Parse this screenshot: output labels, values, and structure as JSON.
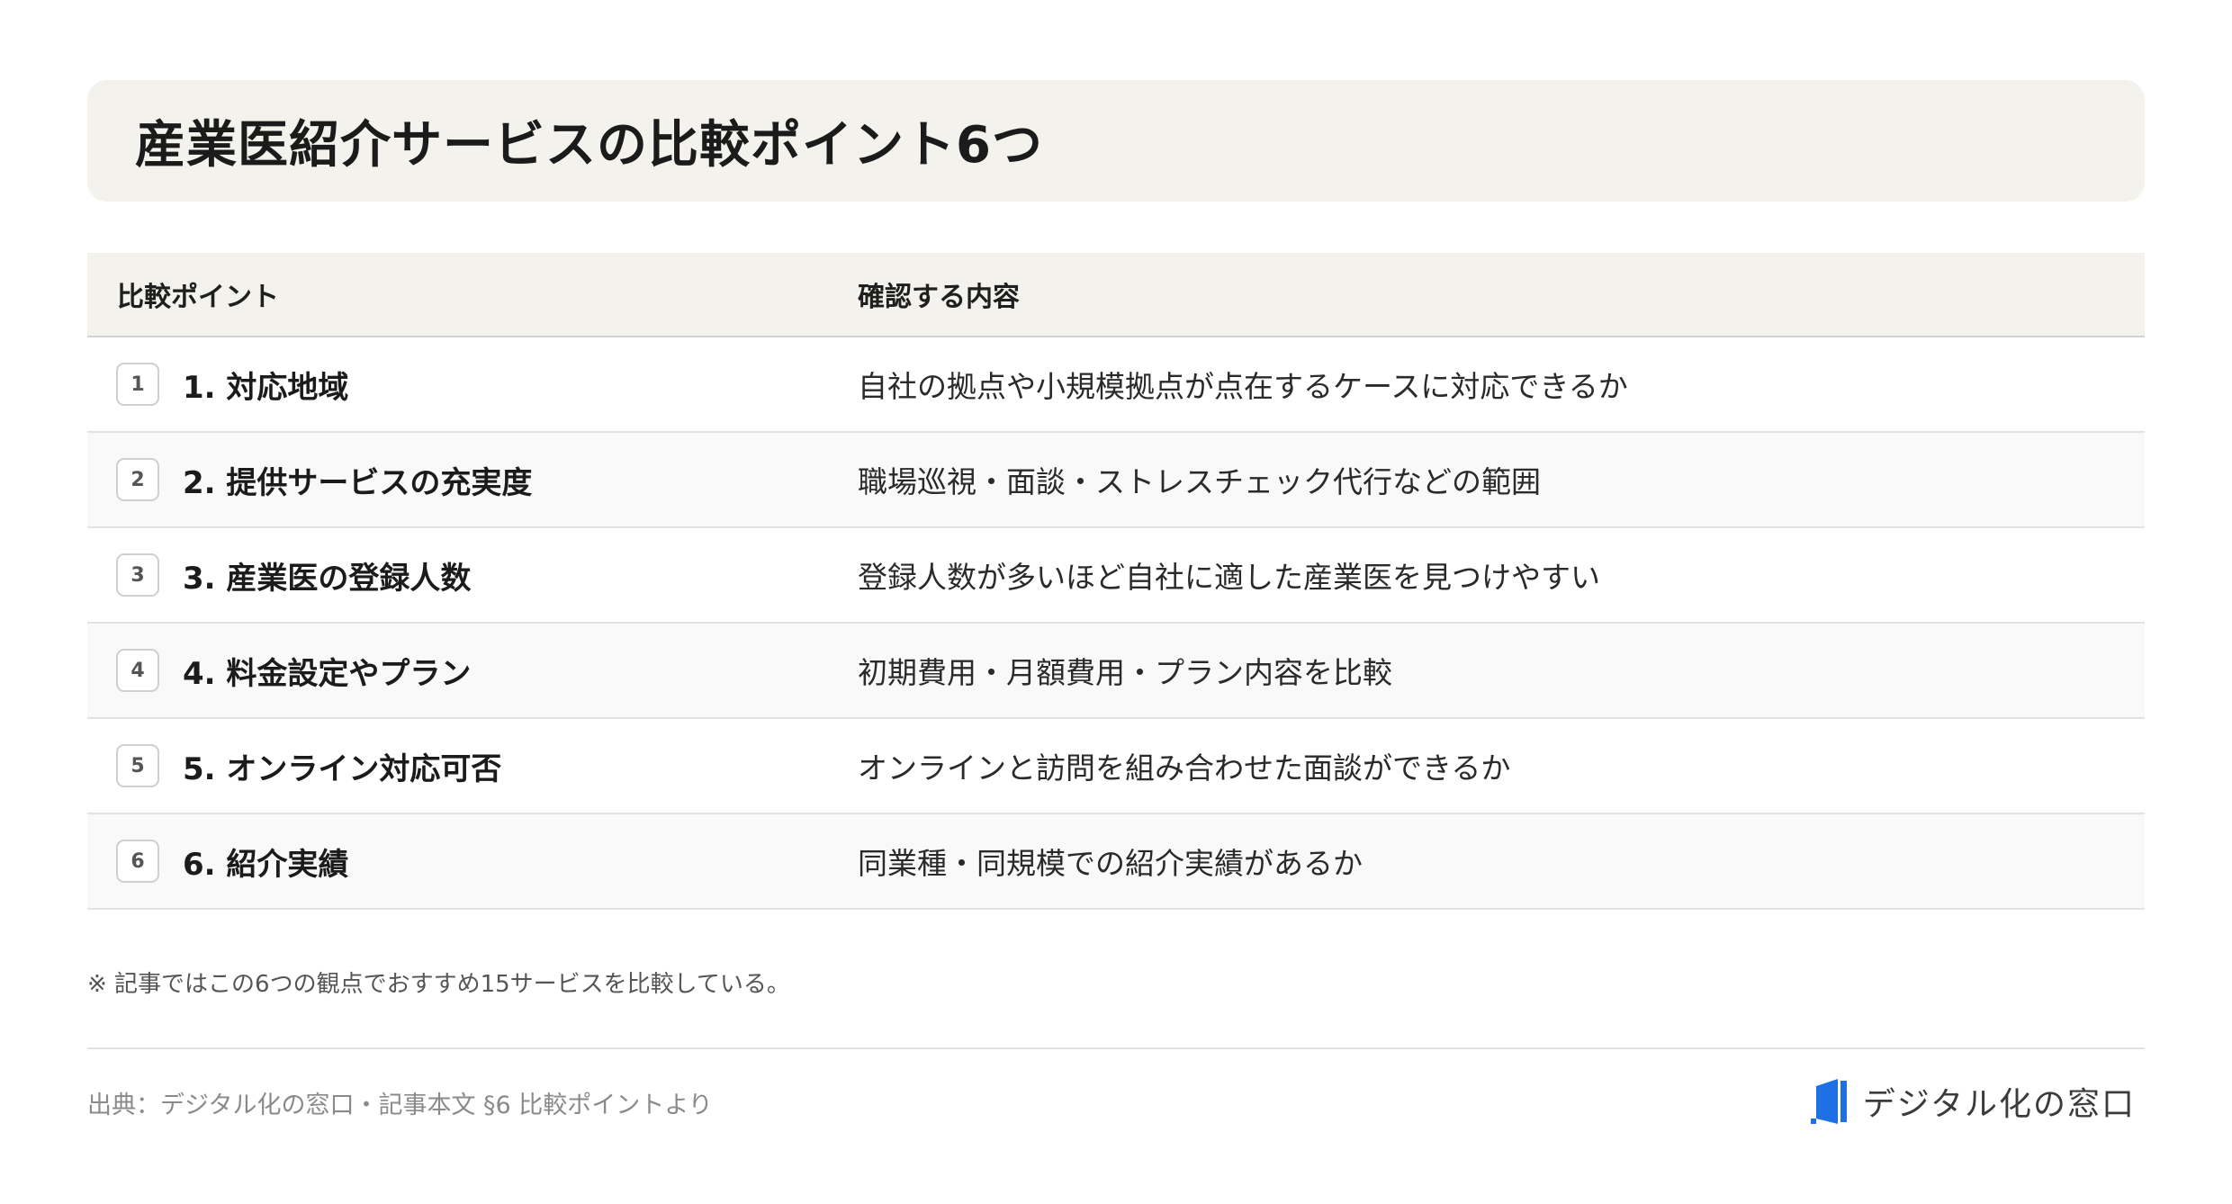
{
  "header": {
    "title": "産業医紹介サービスの比較ポイント6つ"
  },
  "table": {
    "col_point": "比較ポイント",
    "col_content": "確認する内容",
    "rows": [
      {
        "num": "1",
        "point": "1. 対応地域",
        "content": "自社の拠点や小規模拠点が点在するケースに対応できるか"
      },
      {
        "num": "2",
        "point": "2. 提供サービスの充実度",
        "content": "職場巡視・面談・ストレスチェック代行などの範囲"
      },
      {
        "num": "3",
        "point": "3. 産業医の登録人数",
        "content": "登録人数が多いほど自社に適した産業医を見つけやすい"
      },
      {
        "num": "4",
        "point": "4. 料金設定やプラン",
        "content": "初期費用・月額費用・プラン内容を比較"
      },
      {
        "num": "5",
        "point": "5. オンライン対応可否",
        "content": "オンラインと訪問を組み合わせた面談ができるか"
      },
      {
        "num": "6",
        "point": "6. 紹介実績",
        "content": "同業種・同規模での紹介実績があるか"
      }
    ]
  },
  "note": "※ 記事ではこの6つの観点でおすすめ15サービスを比較している。",
  "footer": {
    "source": "出典：デジタル化の窓口・記事本文 §6 比較ポイントより",
    "brand_name": "デジタル化の窓口",
    "brand_logo_icon": "window-logo-icon"
  },
  "colors": {
    "title_bg": "#f4f2ec",
    "brand_blue": "#1f6fe5"
  }
}
